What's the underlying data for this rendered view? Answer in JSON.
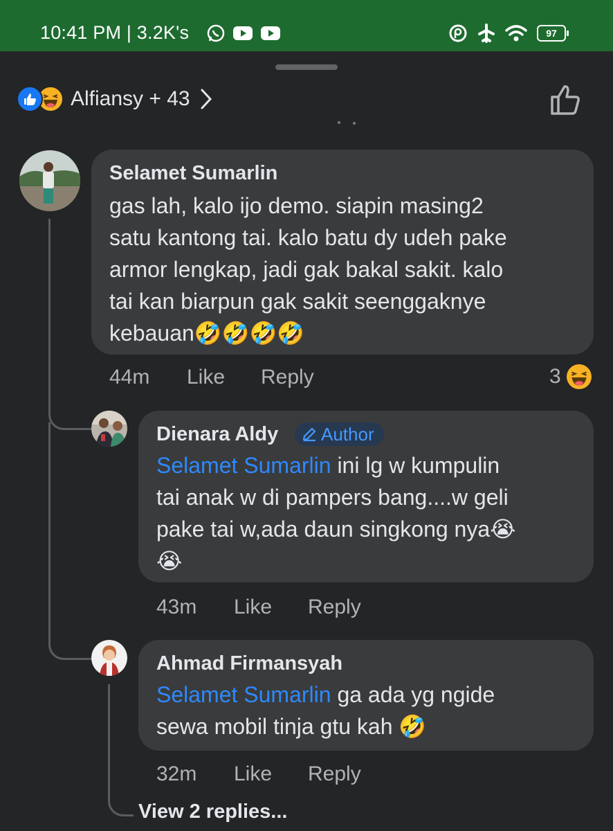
{
  "status_bar": {
    "text": "10:41 PM | 3.2K's",
    "battery": "97",
    "background": "#1e6b30"
  },
  "reactions": {
    "icons": [
      "like-icon",
      "haha-icon"
    ],
    "reactors_text": "Alfiansy + 43"
  },
  "comments": [
    {
      "author": "Selamet Sumarlin",
      "text": "gas lah, kalo ijo demo. siapin masing2 satu kantong tai. kalo batu dy udeh pake armor lengkap, jadi gak bakal sakit. kalo tai kan biarpun gak sakit seenggaknye kebauan",
      "lines": [
        "gas lah, kalo ijo demo. siapin masing2",
        "satu kantong tai. kalo batu dy udeh pake",
        "armor lengkap, jadi gak bakal sakit. kalo",
        "tai kan biarpun gak sakit seenggaknye",
        "kebauan"
      ],
      "emoji": "🤣🤣🤣🤣",
      "time": "44m",
      "like_label": "Like",
      "reply_label": "Reply",
      "reaction_count": "3"
    },
    {
      "author": "Dienara Aldy",
      "badge": "Author",
      "mention": "Selamet Sumarlin",
      "lines": [
        " ini lg w kumpulin",
        "tai anak w di pampers bang....w geli",
        "pake tai w,ada daun singkong nya"
      ],
      "emoji_line3": "😭",
      "emoji_line4": "😭",
      "time": "43m",
      "like_label": "Like",
      "reply_label": "Reply"
    },
    {
      "author": "Ahmad Firmansyah",
      "mention": "Selamet Sumarlin",
      "lines": [
        " ga ada yg ngide",
        "sewa mobil tinja gtu kah "
      ],
      "emoji": "🤣",
      "time": "32m",
      "like_label": "Like",
      "reply_label": "Reply"
    }
  ],
  "view_replies": "View 2 replies...",
  "colors": {
    "background": "#242526",
    "bubble": "#3a3b3c",
    "mention": "#2e89ff",
    "secondary_text": "#b0b3b8"
  }
}
